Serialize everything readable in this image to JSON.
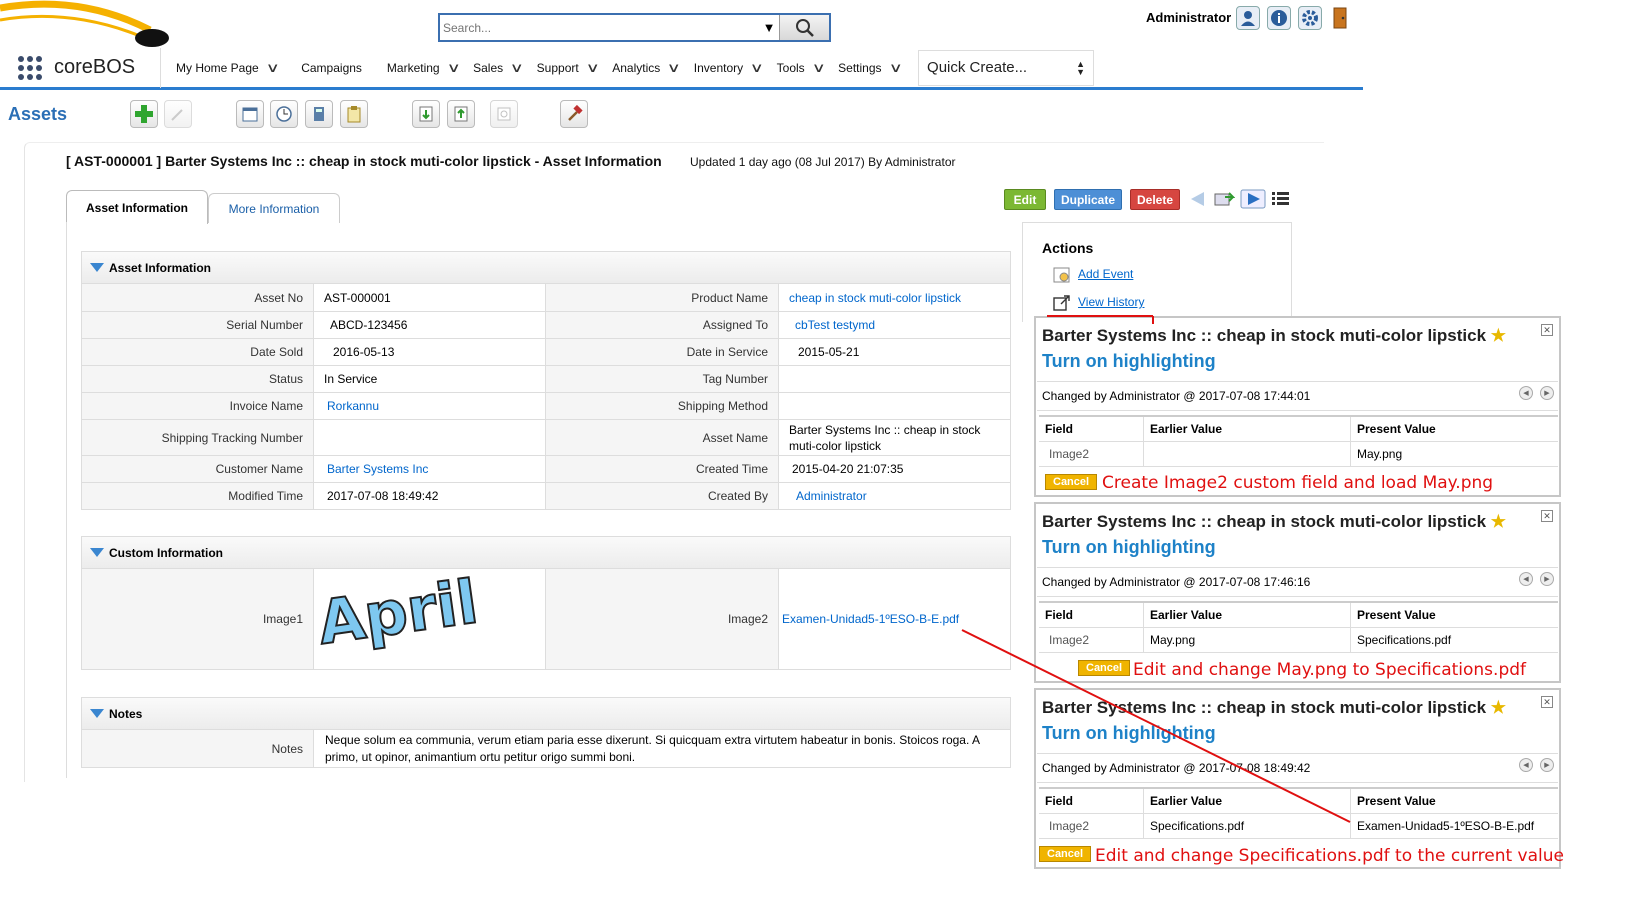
{
  "header": {
    "search_placeholder": "Search...",
    "user": "Administrator",
    "app_name": "coreBOS",
    "nav": [
      "My Home Page",
      "Campaigns",
      "Marketing",
      "Sales",
      "Support",
      "Analytics",
      "Inventory",
      "Tools",
      "Settings"
    ],
    "quick_create": "Quick Create..."
  },
  "module": {
    "title": "Assets"
  },
  "record": {
    "title": "[ AST-000001 ] Barter Systems Inc :: cheap in stock muti-color lipstick - Asset Information",
    "updated": "Updated 1 day ago (08 Jul 2017) By Administrator",
    "tabs": [
      "Asset Information",
      "More Information"
    ],
    "buttons": {
      "edit": "Edit",
      "duplicate": "Duplicate",
      "delete": "Delete"
    }
  },
  "asset_info": {
    "heading": "Asset Information",
    "rows": [
      {
        "l1": "Asset No",
        "v1": "AST-000001",
        "l2": "Product Name",
        "v2": "cheap in stock muti-color lipstick"
      },
      {
        "l1": "Serial Number",
        "v1": "ABCD-123456",
        "l2": "Assigned To",
        "v2": "cbTest testymd"
      },
      {
        "l1": "Date Sold",
        "v1": "2016-05-13",
        "l2": "Date in Service",
        "v2": "2015-05-21"
      },
      {
        "l1": "Status",
        "v1": "In Service",
        "l2": "Tag Number",
        "v2": ""
      },
      {
        "l1": "Invoice Name",
        "v1": "Rorkannu",
        "l2": "Shipping Method",
        "v2": ""
      },
      {
        "l1": "Shipping Tracking Number",
        "v1": "",
        "l2": "Asset Name",
        "v2": "Barter Systems Inc :: cheap in stock muti-color lipstick"
      },
      {
        "l1": "Customer Name",
        "v1": "Barter Systems Inc",
        "l2": "Created Time",
        "v2": "2015-04-20 21:07:35"
      },
      {
        "l1": "Modified Time",
        "v1": "2017-07-08 18:49:42",
        "l2": "Created By",
        "v2": "Administrator"
      }
    ]
  },
  "custom_info": {
    "heading": "Custom Information",
    "image1_label": "Image1",
    "image1_art": "April",
    "image2_label": "Image2",
    "image2_value": "Examen-Unidad5-1ºESO-B-E.pdf"
  },
  "notes": {
    "heading": "Notes",
    "label": "Notes",
    "text": "Neque solum ea communia, verum etiam paria esse dixerunt. Si quicquam extra virtutem habeatur in bonis. Stoicos roga. A primo, ut opinor, animantium ortu petitur origo summi boni."
  },
  "actions": {
    "title": "Actions",
    "add_event": "Add Event",
    "view_history": "View History"
  },
  "history": [
    {
      "title": "Barter Systems Inc :: cheap in stock muti-color lipstick",
      "highlight": "Turn on highlighting",
      "changed": "Changed by Administrator @ 2017-07-08 17:44:01",
      "headers": [
        "Field",
        "Earlier Value",
        "Present Value"
      ],
      "row": [
        "Image2",
        "",
        "May.png"
      ],
      "cancel": "Cancel",
      "note": "Create Image2 custom field and load May.png"
    },
    {
      "title": "Barter Systems Inc :: cheap in stock muti-color lipstick",
      "highlight": "Turn on highlighting",
      "changed": "Changed by Administrator @ 2017-07-08 17:46:16",
      "headers": [
        "Field",
        "Earlier Value",
        "Present Value"
      ],
      "row": [
        "Image2",
        "May.png",
        "Specifications.pdf"
      ],
      "cancel": "Cancel",
      "note": "Edit and change May.png to Specifications.pdf"
    },
    {
      "title": "Barter Systems Inc :: cheap in stock muti-color lipstick",
      "highlight": "Turn on highlighting",
      "changed": "Changed by Administrator @ 2017-07-08 18:49:42",
      "headers": [
        "Field",
        "Earlier Value",
        "Present Value"
      ],
      "row": [
        "Image2",
        "Specifications.pdf",
        "Examen-Unidad5-1ºESO-B-E.pdf"
      ],
      "cancel": "Cancel",
      "note": "Edit and change Specifications.pdf to the current value"
    }
  ]
}
